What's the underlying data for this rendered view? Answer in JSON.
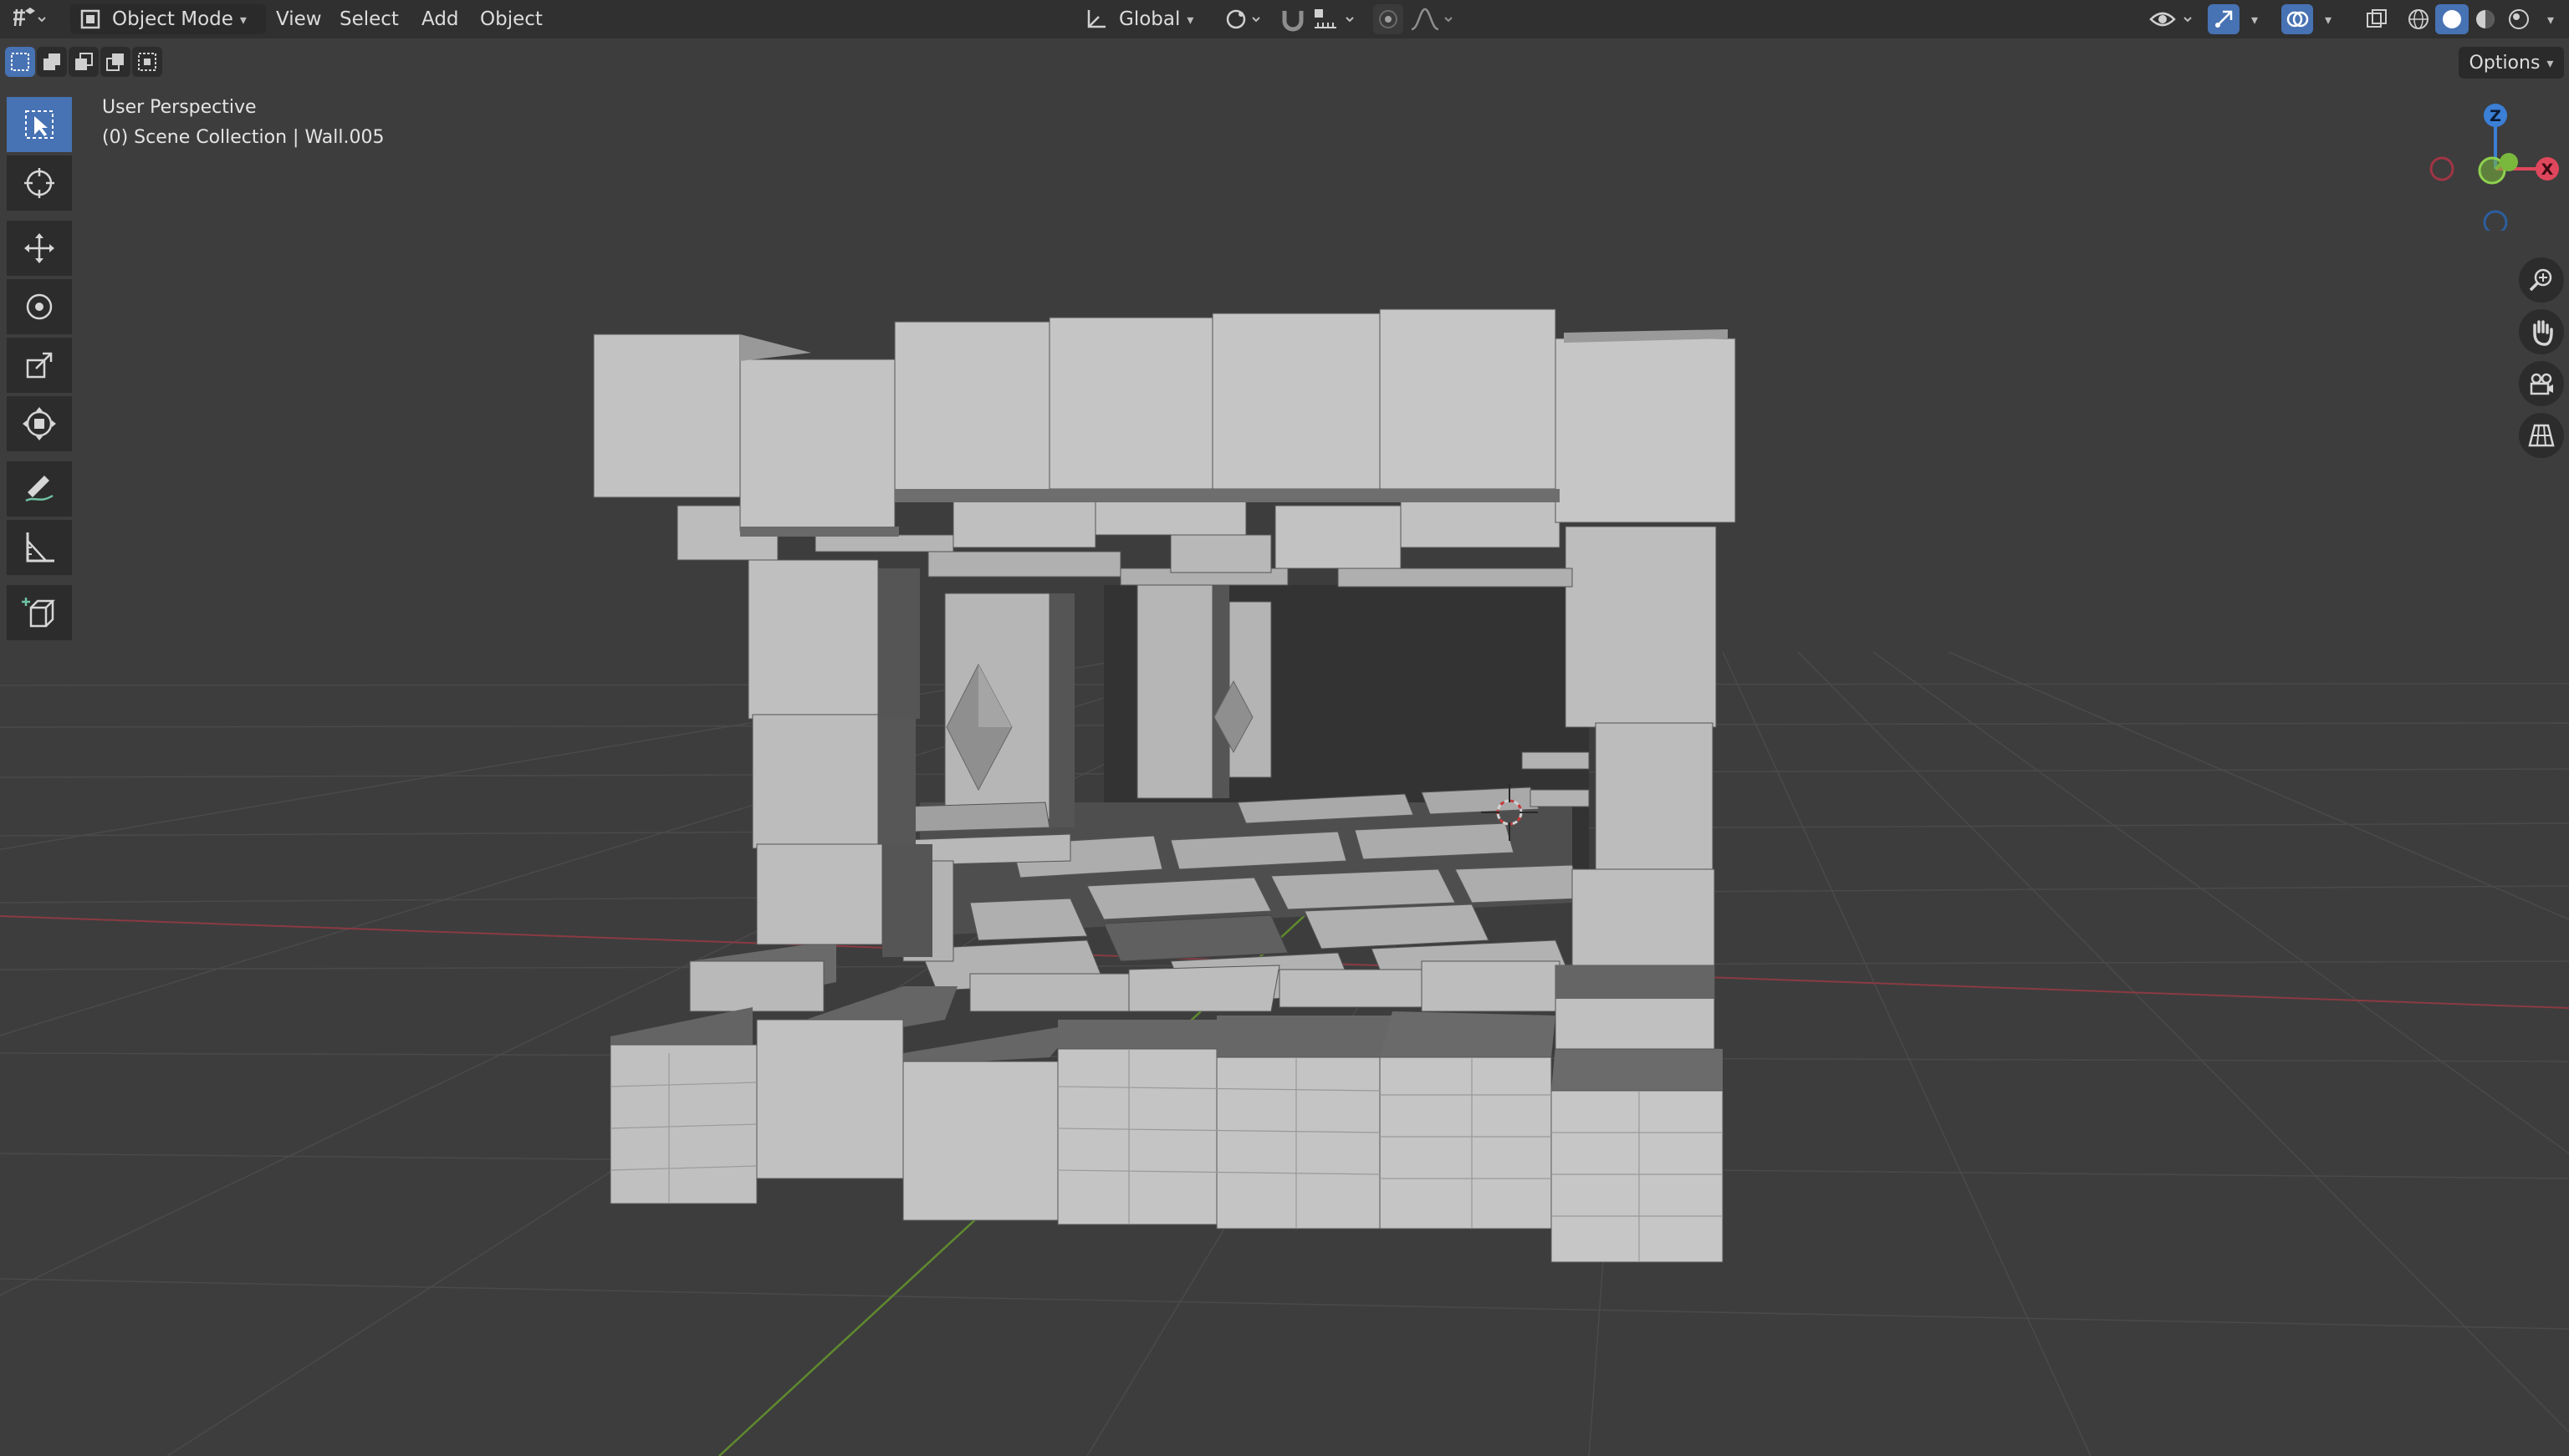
{
  "header": {
    "mode_label": "Object Mode",
    "menus": [
      "View",
      "Select",
      "Add",
      "Object"
    ],
    "transform_orientation": "Global",
    "options_label": "Options"
  },
  "viewport": {
    "perspective_label": "User Perspective",
    "collection_label": "(0) Scene Collection | Wall.005"
  },
  "gizmo": {
    "z_label": "Z",
    "x_label": "X"
  },
  "tools": [
    "select-box",
    "cursor",
    "move",
    "rotate",
    "scale",
    "transform",
    "annotate",
    "measure",
    "add-cube"
  ],
  "colors": {
    "background": "#3d3d3d",
    "header": "#303030",
    "accent": "#4772b3",
    "x_axis": "#e0475c",
    "y_axis": "#7ab83d",
    "z_axis": "#3b7fd6"
  }
}
